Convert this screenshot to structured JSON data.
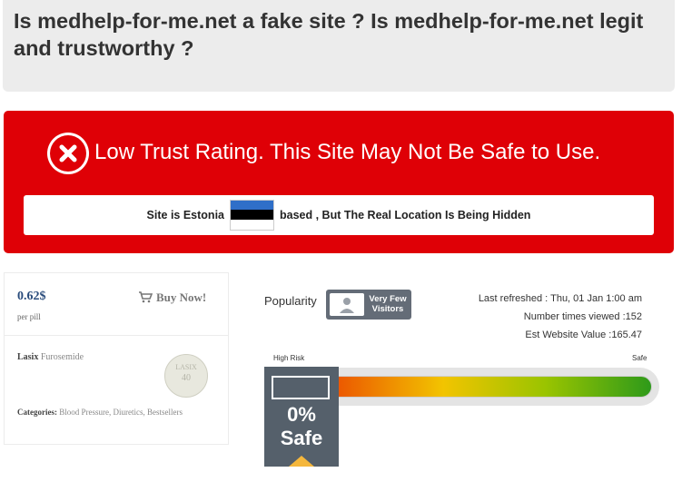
{
  "header": {
    "title": "Is medhelp-for-me.net a fake site ? Is medhelp-for-me.net legit and trustworthy ?"
  },
  "alert": {
    "headline": "Low Trust Rating. This Site May Not Be Safe to Use.",
    "location_prefix": "Site is Estonia",
    "location_suffix": "based , But The Real Location Is Being Hidden",
    "colors": {
      "background": "#df0006"
    }
  },
  "product": {
    "price": "0.62$",
    "per_unit": "per pill",
    "buy_label": "Buy Now!",
    "drug_name": "Lasix",
    "drug_generic": "Furosemide",
    "pill_imprint_top": "LASIX",
    "pill_imprint_bottom": "40",
    "categories_label": "Categories:",
    "categories": "Blood Pressure, Diuretics, Bestsellers"
  },
  "stats": {
    "popularity_label": "Popularity",
    "popularity_badge": "Very Few Visitors",
    "last_refreshed": "Last refreshed : Thu, 01 Jan 1:00 am",
    "times_viewed": "Number times viewed :152",
    "est_value": "Est Website Value :165.47"
  },
  "gauge": {
    "label_left": "High Risk",
    "label_right": "Safe",
    "percent_text": "0%",
    "status_text": "Safe",
    "safety_fraction": 0.0
  }
}
